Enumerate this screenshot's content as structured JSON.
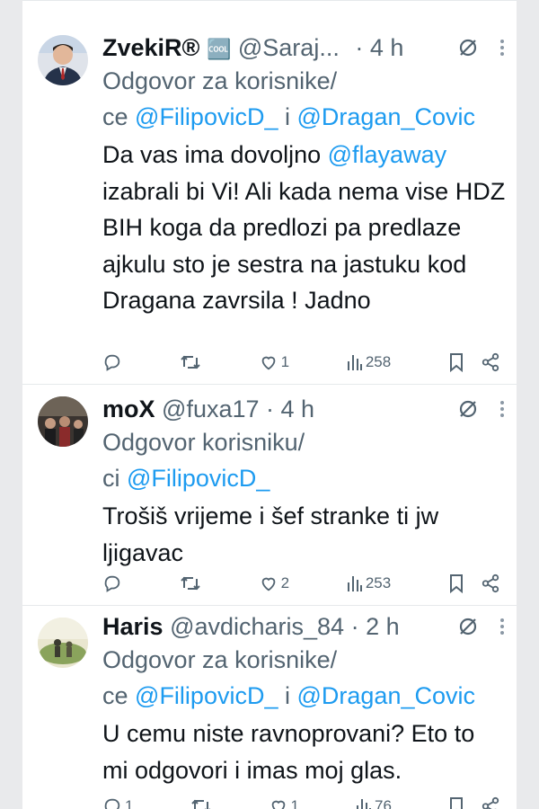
{
  "tweets": [
    {
      "name": "ZvekiR®",
      "badge": "🆒",
      "handle": "@Saraj...",
      "time": "· 4 h",
      "reply_prefix": "Odgovor za korisnike/",
      "reply_line2_prefix": "ce ",
      "mention1": "@FilipovicD_",
      "reply_joiner": " i ",
      "mention2": "@Dragan_Covic",
      "text_prefix": "Da vas ima dovoljno ",
      "text_mention": "@flayaway",
      "text_rest": " izabrali bi Vi! Ali kada nema vise HDZ BIH koga da predlozi pa predlaze ajkulu sto je sestra na jastuku kod Dragana zavrsila ! Jadno",
      "likes": "1",
      "views": "258"
    },
    {
      "name": "moX",
      "handle": "@fuxa17",
      "time": "· 4 h",
      "reply_prefix": "Odgovor korisniku/",
      "reply_line2_prefix": "ci ",
      "mention1": "@FilipovicD_",
      "text": "Trošiš vrijeme i šef stranke ti jw ljigavac",
      "likes": "2",
      "views": "253"
    },
    {
      "name": "Haris",
      "handle": "@avdicharis_84",
      "time": "· 2 h",
      "reply_prefix": "Odgovor za korisnike/",
      "reply_line2_prefix": "ce ",
      "mention1": "@FilipovicD_",
      "reply_joiner": " i ",
      "mention2": "@Dragan_Covic",
      "text": "U cemu niste ravnoprovani? Eto to mi odgovori i imas moj glas.",
      "replies": "1",
      "likes": "1",
      "views": "76"
    }
  ],
  "colors": {
    "text": "#0f1419",
    "secondary": "#536471",
    "link": "#1d9bf0",
    "border": "#e6e9eb",
    "background_side": "#e9eaec"
  },
  "icons": [
    "reply-icon",
    "retweet-icon",
    "like-icon",
    "views-icon",
    "bookmark-icon",
    "share-icon",
    "mute-icon",
    "more-icon"
  ]
}
